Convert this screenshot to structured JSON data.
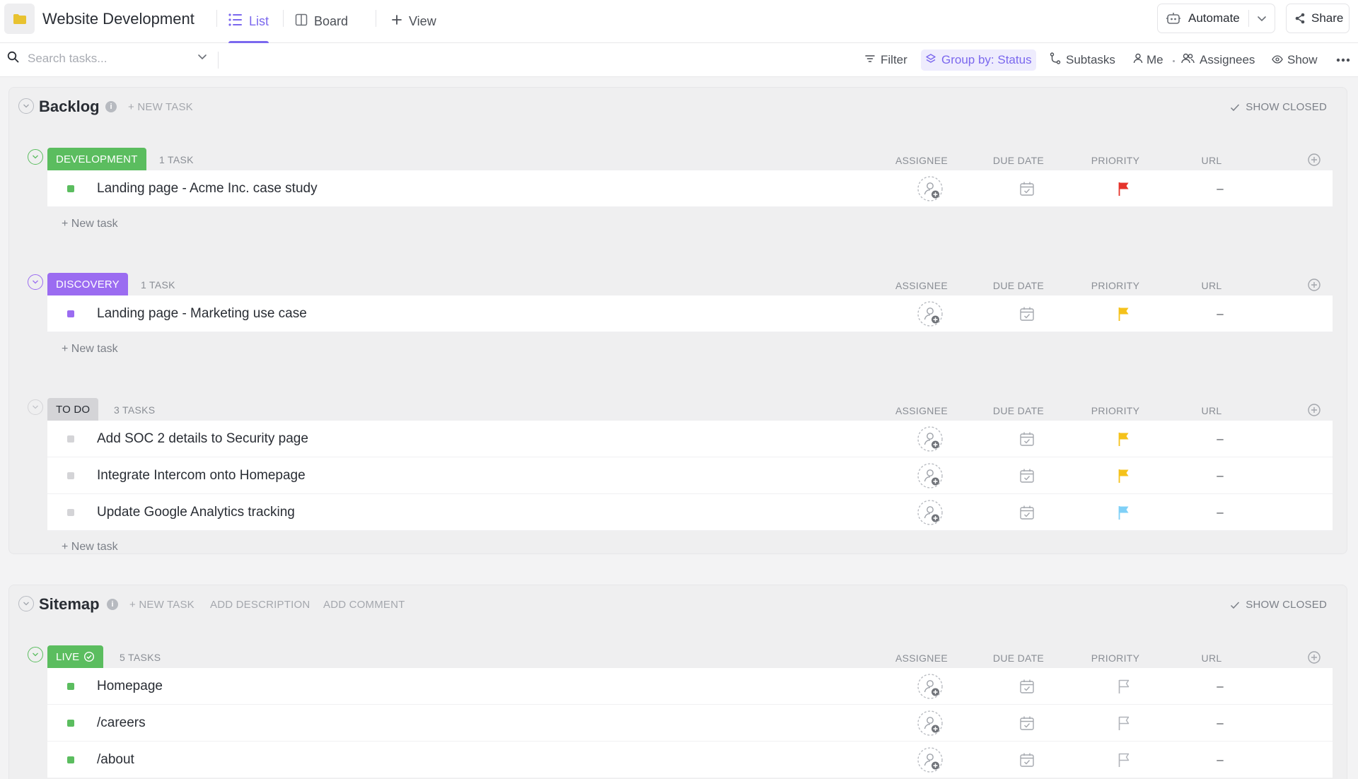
{
  "header": {
    "title": "Website Development",
    "tabs": [
      {
        "label": "List",
        "active": true
      },
      {
        "label": "Board",
        "active": false
      }
    ],
    "add_view_label": "View",
    "automate_label": "Automate",
    "share_label": "Share"
  },
  "toolbar": {
    "search_placeholder": "Search tasks...",
    "filter_label": "Filter",
    "group_by_label": "Group by: Status",
    "subtasks_label": "Subtasks",
    "me_label": "Me",
    "assignees_label": "Assignees",
    "show_label": "Show"
  },
  "columns": {
    "assignee": "ASSIGNEE",
    "due_date": "DUE DATE",
    "priority": "PRIORITY",
    "url": "URL"
  },
  "colors": {
    "accent": "#7b68ee",
    "development": "#5bbd5f",
    "discovery": "#9b6cf1",
    "todo": "#d4d4d7",
    "live": "#5bbd5f",
    "priority_urgent": "#e5342c",
    "priority_high": "#f5c21b",
    "priority_normal": "#7fd0f7",
    "priority_none": "#b0b3b9"
  },
  "lists": [
    {
      "title": "Backlog",
      "new_task_label": "+ NEW TASK",
      "show_closed_label": "SHOW CLOSED",
      "groups": [
        {
          "status": "DEVELOPMENT",
          "count_label": "1 TASK",
          "new_task_label": "+ New task",
          "tasks": [
            {
              "name": "Landing page - Acme Inc. case study",
              "priority": "urgent",
              "url": "–"
            }
          ]
        },
        {
          "status": "DISCOVERY",
          "count_label": "1 TASK",
          "new_task_label": "+ New task",
          "tasks": [
            {
              "name": "Landing page - Marketing use case",
              "priority": "high",
              "url": "–"
            }
          ]
        },
        {
          "status": "TO DO",
          "count_label": "3 TASKS",
          "new_task_label": "+ New task",
          "tasks": [
            {
              "name": "Add SOC 2 details to Security page",
              "priority": "high",
              "url": "–"
            },
            {
              "name": "Integrate Intercom onto Homepage",
              "priority": "high",
              "url": "–"
            },
            {
              "name": "Update Google Analytics tracking",
              "priority": "normal",
              "url": "–"
            }
          ]
        }
      ]
    },
    {
      "title": "Sitemap",
      "new_task_label": "+ NEW TASK",
      "add_description_label": "ADD DESCRIPTION",
      "add_comment_label": "ADD COMMENT",
      "show_closed_label": "SHOW CLOSED",
      "groups": [
        {
          "status": "LIVE",
          "count_label": "5 TASKS",
          "tasks": [
            {
              "name": "Homepage",
              "priority": "none",
              "url": "–"
            },
            {
              "name": "/careers",
              "priority": "none",
              "url": "–"
            },
            {
              "name": "/about",
              "priority": "none",
              "url": "–"
            }
          ]
        }
      ]
    }
  ]
}
